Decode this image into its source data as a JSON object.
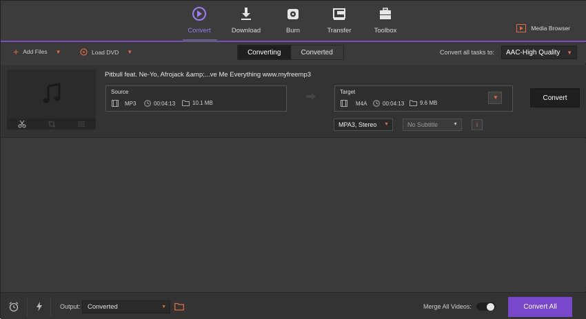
{
  "nav": {
    "tabs": [
      {
        "label": "Convert",
        "icon": "convert-icon",
        "active": true
      },
      {
        "label": "Download",
        "icon": "download-icon",
        "active": false
      },
      {
        "label": "Burn",
        "icon": "burn-icon",
        "active": false
      },
      {
        "label": "Transfer",
        "icon": "transfer-icon",
        "active": false
      },
      {
        "label": "Toolbox",
        "icon": "toolbox-icon",
        "active": false
      }
    ],
    "media_browser": "Media Browser"
  },
  "toolbar": {
    "add_files": "Add Files",
    "load_dvd": "Load DVD",
    "segments": [
      "Converting",
      "Converted"
    ],
    "active_segment": "Converting",
    "convert_all_label": "Convert all tasks to:",
    "convert_all_value": "AAC-High Quality"
  },
  "file": {
    "title": "Pitbull feat. Ne-Yo, Afrojack &amp;...ve Me Everything www.myfreemp3",
    "source": {
      "label": "Source",
      "format": "MP3",
      "duration": "00:04:13",
      "size": "10.1 MB"
    },
    "target": {
      "label": "Target",
      "format": "M4A",
      "duration": "00:04:13",
      "size": "9.6 MB"
    },
    "audio_track": "MPA3, Stereo",
    "subtitle": "No Subtitle",
    "info_button": "i",
    "convert_button": "Convert"
  },
  "bottom": {
    "output_label": "Output:",
    "output_value": "Converted",
    "merge_label": "Merge All Videos:",
    "merge_enabled": false,
    "convert_all_button": "Convert All"
  },
  "colors": {
    "accent_purple": "#7748c9",
    "accent_orange": "#e06b45",
    "active_tab": "#9d7ff0"
  }
}
